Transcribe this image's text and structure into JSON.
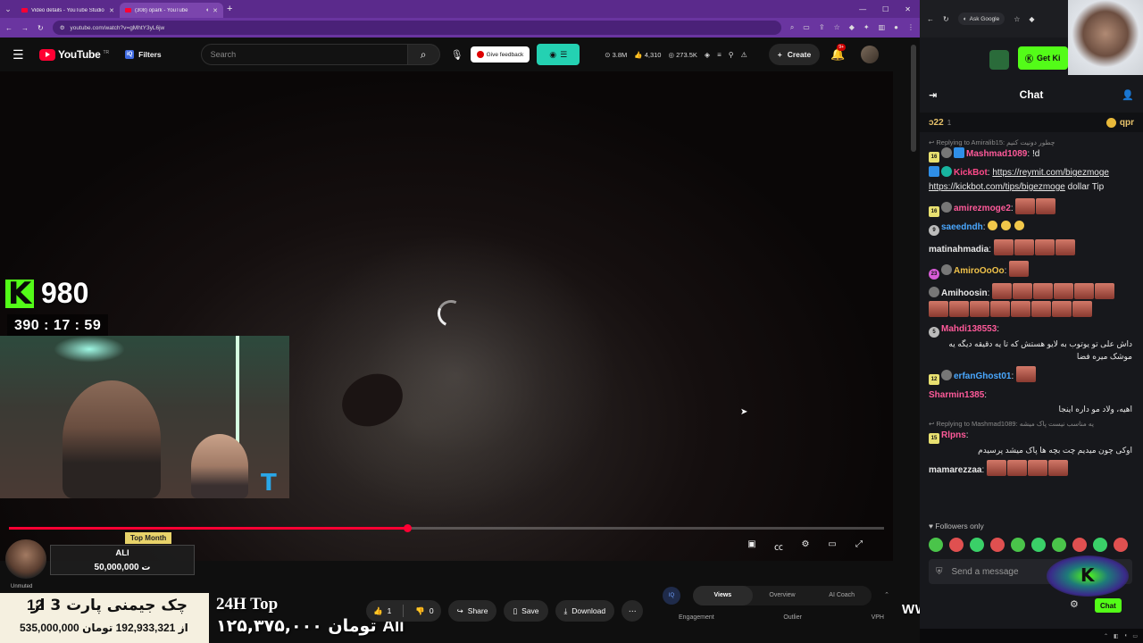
{
  "browser": {
    "tabs": [
      {
        "title": "Video details - YouTube Studio",
        "active": false
      },
      {
        "title": "(308) opark - YouTube",
        "active": true
      }
    ],
    "url": "youtube.com/watch?v=gMhtY3yL6jw"
  },
  "youtube": {
    "wordmark": "YouTube",
    "country": "TR",
    "filters_label": "Filters",
    "search_placeholder": "Search",
    "feedback_label": "Give feedback",
    "stats": {
      "views": "3.8M",
      "likes": "4,310",
      "eye_count": "273.5K"
    },
    "create_label": "Create",
    "notif_badge": "9+"
  },
  "overlay": {
    "kick_count": "980",
    "timer": "390 : 17 : 59",
    "top_month": "Top Month",
    "donor_name": "ALI",
    "donor_amount": "50,000,000 ت",
    "unmuted": "Unmuted",
    "lower_third_title": "چک جیمنی پارت 3 از",
    "lower_third_num": "12",
    "lower_third_sub": "535,000,000 از 192,933,321 تومان",
    "top24_title": "24H Top",
    "top24_amount": "۱۲۵,۳۷۵,۰۰۰ تومان",
    "top24_name": "Ali",
    "watermark": "WWW.SKYPC.IR"
  },
  "player": {
    "progress": 0.455
  },
  "actions": {
    "likes": "1",
    "dislikes": "0",
    "share": "Share",
    "save": "Save",
    "download": "Download"
  },
  "analytics": {
    "tabs": [
      "Views",
      "Overview",
      "AI Coach"
    ],
    "metrics": [
      "Engagement",
      "Outlier",
      "VPH"
    ]
  },
  "chat": {
    "ask_google": "Ask Google",
    "get_kick": "Get Ki",
    "title": "Chat",
    "pinned_left": "ɔ22",
    "pinned_left_count": "1",
    "pinned_right": "qpr",
    "messages": [
      {
        "reply": "Replying to Amiralib15: چطور دونیت کنیم",
        "badges": [
          "y:16",
          "gray",
          "blue"
        ],
        "user": "Mashmad1089",
        "color": "#ff5a9a",
        "text": "!d"
      },
      {
        "badges": [
          "blue",
          "teal"
        ],
        "user": "KickBot",
        "color": "#ff4a8a",
        "links": [
          "https://reymit.com/bigezmoge",
          "https://kickbot.com/tips/bigezmoge"
        ],
        "text": "dollar Tip"
      },
      {
        "badges": [
          "y:16",
          "gray"
        ],
        "user": "amirezmoge2",
        "color": "#ff5a9a",
        "emotes": 2
      },
      {
        "badges": [
          "circ:9"
        ],
        "user": "saeedndh",
        "color": "#4aa8ff",
        "laughs": 3
      },
      {
        "badges": [],
        "user": "matinahmadia",
        "color": "#e8e8e8",
        "emotes": 4
      },
      {
        "badges": [
          "pink:23",
          "gray"
        ],
        "user": "AmiroOoOo",
        "color": "#f0c24a",
        "emotes": 1
      },
      {
        "badges": [
          "gray"
        ],
        "user": "Amihoosin",
        "color": "#e8e8e8",
        "emotes": 14
      },
      {
        "badges": [
          "circ:5"
        ],
        "user": "Mahdi138553",
        "color": "#ff5a9a",
        "text": "داش علی تو یوتوب به لایو هستش که تا یه دقیقه دیگه یه موشک میره فضا"
      },
      {
        "badges": [
          "y:12",
          "gray"
        ],
        "user": "erfanGhost01",
        "color": "#4aa8ff",
        "emotes": 1
      },
      {
        "badges": [],
        "user": "Sharmin1385",
        "color": "#ff5a9a",
        "text": "اهیه، ولاد مو داره اینجا"
      },
      {
        "reply": "Replying to Mashmad1089: یه مناسب نیست پاک میشه",
        "badges": [
          "y:15"
        ],
        "user": "Rlpns",
        "color": "#ff5a9a",
        "text": "اوکی چون میدیم چت بچه ها پاک میشد پرسیدم"
      },
      {
        "badges": [],
        "user": "mamarezzaa",
        "color": "#e8e8e8",
        "emotes": 4
      }
    ],
    "followers_only": "Followers only",
    "send_placeholder": "Send a message",
    "chat_button": "Chat"
  }
}
